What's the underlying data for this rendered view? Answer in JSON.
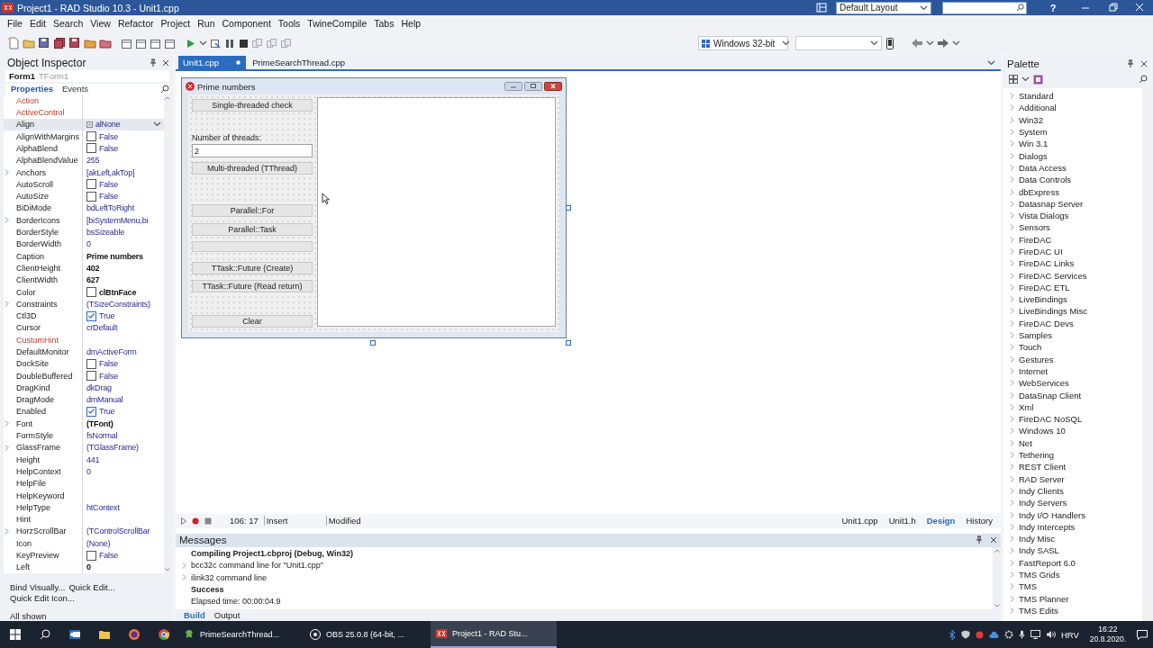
{
  "window": {
    "title": "Project1 - RAD Studio 10.3 - Unit1.cpp",
    "layout": "Default Layout",
    "help": "?"
  },
  "menu": [
    "File",
    "Edit",
    "Search",
    "View",
    "Refactor",
    "Project",
    "Run",
    "Component",
    "Tools",
    "TwineCompile",
    "Tabs",
    "Help"
  ],
  "toolbar": {
    "platform": "Windows 32-bit"
  },
  "object_inspector": {
    "title": "Object Inspector",
    "object": "Form1",
    "object_type": "TForm1",
    "tabs": [
      {
        "label": "Properties",
        "selected": true
      },
      {
        "label": "Events",
        "selected": false
      }
    ],
    "properties": [
      {
        "name": "Action",
        "kind": "text",
        "expandable": false,
        "reference": true,
        "selected": false
      },
      {
        "name": "ActiveControl",
        "kind": "text",
        "expandable": false,
        "reference": true,
        "selected": false
      },
      {
        "name": "Align",
        "value": "alNone",
        "kind": "dropdown",
        "modified": false,
        "expandable": false,
        "reference": false,
        "selected": true
      },
      {
        "name": "AlignWithMargins",
        "value": "False",
        "kind": "check",
        "checked": false,
        "modified": false,
        "expandable": false,
        "reference": false,
        "selected": false
      },
      {
        "name": "AlphaBlend",
        "value": "False",
        "kind": "check",
        "checked": false,
        "modified": false,
        "expandable": false,
        "reference": false,
        "selected": false
      },
      {
        "name": "AlphaBlendValue",
        "value": "255",
        "kind": "text",
        "modified": false,
        "expandable": false,
        "reference": false,
        "selected": false
      },
      {
        "name": "Anchors",
        "value": "[akLeft,akTop]",
        "kind": "text",
        "modified": false,
        "expandable": true,
        "reference": false,
        "selected": false
      },
      {
        "name": "AutoScroll",
        "value": "False",
        "kind": "check",
        "checked": false,
        "modified": false,
        "expandable": false,
        "reference": false,
        "selected": false
      },
      {
        "name": "AutoSize",
        "value": "False",
        "kind": "check",
        "checked": false,
        "modified": false,
        "expandable": false,
        "reference": false,
        "selected": false
      },
      {
        "name": "BiDiMode",
        "value": "bdLeftToRight",
        "kind": "text",
        "modified": false,
        "expandable": false,
        "reference": false,
        "selected": false
      },
      {
        "name": "BorderIcons",
        "value": "[biSystemMenu,bi",
        "kind": "text",
        "modified": false,
        "expandable": true,
        "reference": false,
        "selected": false
      },
      {
        "name": "BorderStyle",
        "value": "bsSizeable",
        "kind": "text",
        "modified": false,
        "expandable": false,
        "reference": false,
        "selected": false
      },
      {
        "name": "BorderWidth",
        "value": "0",
        "kind": "text",
        "modified": false,
        "expandable": false,
        "reference": false,
        "selected": false
      },
      {
        "name": "Caption",
        "value": "Prime numbers",
        "kind": "text",
        "modified": true,
        "expandable": false,
        "reference": false,
        "selected": false
      },
      {
        "name": "ClientHeight",
        "value": "402",
        "kind": "text",
        "modified": true,
        "expandable": false,
        "reference": false,
        "selected": false
      },
      {
        "name": "ClientWidth",
        "value": "627",
        "kind": "text",
        "modified": true,
        "expandable": false,
        "reference": false,
        "selected": false
      },
      {
        "name": "Color",
        "value": "clBtnFace",
        "kind": "swatch",
        "modified": true,
        "expandable": false,
        "reference": false,
        "selected": false
      },
      {
        "name": "Constraints",
        "value": "(TSizeConstraints)",
        "kind": "text",
        "modified": false,
        "expandable": true,
        "reference": false,
        "selected": false
      },
      {
        "name": "Ctl3D",
        "value": "True",
        "kind": "check",
        "checked": true,
        "modified": false,
        "expandable": false,
        "reference": false,
        "selected": false
      },
      {
        "name": "Cursor",
        "value": "crDefault",
        "kind": "text",
        "modified": false,
        "expandable": false,
        "reference": false,
        "selected": false
      },
      {
        "name": "CustomHint",
        "kind": "text",
        "expandable": false,
        "reference": true,
        "selected": false
      },
      {
        "name": "DefaultMonitor",
        "value": "dmActiveForm",
        "kind": "text",
        "modified": false,
        "expandable": false,
        "reference": false,
        "selected": false
      },
      {
        "name": "DockSite",
        "value": "False",
        "kind": "check",
        "checked": false,
        "modified": false,
        "expandable": false,
        "reference": false,
        "selected": false
      },
      {
        "name": "DoubleBuffered",
        "value": "False",
        "kind": "check",
        "checked": false,
        "modified": false,
        "expandable": false,
        "reference": false,
        "selected": false
      },
      {
        "name": "DragKind",
        "value": "dkDrag",
        "kind": "text",
        "modified": false,
        "expandable": false,
        "reference": false,
        "selected": false
      },
      {
        "name": "DragMode",
        "value": "dmManual",
        "kind": "text",
        "modified": false,
        "expandable": false,
        "reference": false,
        "selected": false
      },
      {
        "name": "Enabled",
        "value": "True",
        "kind": "check",
        "checked": true,
        "modified": false,
        "expandable": false,
        "reference": false,
        "selected": false
      },
      {
        "name": "Font",
        "value": "(TFont)",
        "kind": "text",
        "modified": true,
        "expandable": true,
        "reference": false,
        "selected": false
      },
      {
        "name": "FormStyle",
        "value": "fsNormal",
        "kind": "text",
        "modified": false,
        "expandable": false,
        "reference": false,
        "selected": false
      },
      {
        "name": "GlassFrame",
        "value": "(TGlassFrame)",
        "kind": "text",
        "modified": false,
        "expandable": true,
        "reference": false,
        "selected": false
      },
      {
        "name": "Height",
        "value": "441",
        "kind": "text",
        "modified": false,
        "expandable": false,
        "reference": false,
        "selected": false
      },
      {
        "name": "HelpContext",
        "value": "0",
        "kind": "text",
        "modified": false,
        "expandable": false,
        "reference": false,
        "selected": false
      },
      {
        "name": "HelpFile",
        "kind": "text",
        "expandable": false,
        "reference": false,
        "selected": false
      },
      {
        "name": "HelpKeyword",
        "kind": "text",
        "expandable": false,
        "reference": false,
        "selected": false
      },
      {
        "name": "HelpType",
        "value": "htContext",
        "kind": "text",
        "modified": false,
        "expandable": false,
        "reference": false,
        "selected": false
      },
      {
        "name": "Hint",
        "kind": "text",
        "expandable": false,
        "reference": false,
        "selected": false
      },
      {
        "name": "HorzScrollBar",
        "value": "(TControlScrollBar",
        "kind": "text",
        "modified": false,
        "expandable": true,
        "reference": false,
        "selected": false
      },
      {
        "name": "Icon",
        "value": "(None)",
        "kind": "text",
        "modified": false,
        "expandable": false,
        "reference": false,
        "selected": false
      },
      {
        "name": "KeyPreview",
        "value": "False",
        "kind": "check",
        "checked": false,
        "modified": false,
        "expandable": false,
        "reference": false,
        "selected": false
      },
      {
        "name": "Left",
        "value": "0",
        "kind": "text",
        "modified": true,
        "expandable": false,
        "reference": false,
        "selected": false
      }
    ],
    "links": [
      "Bind Visually...",
      "Quick Edit...",
      "Quick Edit Icon..."
    ],
    "filter": "All shown"
  },
  "editor_tabs": [
    {
      "label": "Unit1.cpp",
      "selected": true
    },
    {
      "label": "PrimeSearchThread.cpp",
      "selected": false
    }
  ],
  "form": {
    "caption": "Prime numbers",
    "controls": [
      {
        "kind": "button",
        "text": "Single-threaded check"
      },
      {
        "kind": "label",
        "text": "Number of threads:"
      },
      {
        "kind": "edit",
        "text": "2"
      },
      {
        "kind": "button",
        "text": "Multi-threaded (TThread)"
      },
      {
        "kind": "button",
        "text": "Parallel::For"
      },
      {
        "kind": "button",
        "text": "Parallel::Task"
      },
      {
        "kind": "progress",
        "level": 0
      },
      {
        "kind": "button",
        "text": "TTask::Future (Create)"
      },
      {
        "kind": "button",
        "text": "TTask::Future (Read return)"
      },
      {
        "kind": "button",
        "text": "Clear"
      }
    ]
  },
  "status_bar": {
    "position": "106: 17",
    "mode": "Insert",
    "state": "Modified",
    "views": [
      {
        "label": "Unit1.cpp",
        "selected": false
      },
      {
        "label": "Unit1.h",
        "selected": false
      },
      {
        "label": "Design",
        "selected": true
      },
      {
        "label": "History",
        "selected": false
      }
    ]
  },
  "messages": {
    "title": "Messages",
    "lines": [
      {
        "text": "Compiling Project1.cbproj (Debug, Win32)",
        "bold": true,
        "expandable": false
      },
      {
        "text": "bcc32c command line for \"Unit1.cpp\"",
        "bold": false,
        "expandable": true
      },
      {
        "text": "ilink32 command line",
        "bold": false,
        "expandable": true
      },
      {
        "text": "Success",
        "bold": true,
        "expandable": false
      },
      {
        "text": "Elapsed time: 00:00:04.9",
        "bold": false,
        "expandable": false
      }
    ],
    "tabs": [
      {
        "label": "Build",
        "selected": true
      },
      {
        "label": "Output",
        "selected": false
      }
    ]
  },
  "palette": {
    "title": "Palette",
    "categories": [
      {
        "label": "Standard",
        "expanded": false
      },
      {
        "label": "Additional",
        "expanded": false
      },
      {
        "label": "Win32",
        "expanded": false
      },
      {
        "label": "System",
        "expanded": false
      },
      {
        "label": "Win 3.1",
        "expanded": false
      },
      {
        "label": "Dialogs",
        "expanded": false
      },
      {
        "label": "Data Access",
        "expanded": false
      },
      {
        "label": "Data Controls",
        "expanded": false
      },
      {
        "label": "dbExpress",
        "expanded": false
      },
      {
        "label": "Datasnap Server",
        "expanded": false
      },
      {
        "label": "Vista Dialogs",
        "expanded": false
      },
      {
        "label": "Sensors",
        "expanded": false
      },
      {
        "label": "FireDAC",
        "expanded": false
      },
      {
        "label": "FireDAC UI",
        "expanded": false
      },
      {
        "label": "FireDAC Links",
        "expanded": false
      },
      {
        "label": "FireDAC Services",
        "expanded": false
      },
      {
        "label": "FireDAC ETL",
        "expanded": false
      },
      {
        "label": "LiveBindings",
        "expanded": false
      },
      {
        "label": "LiveBindings Misc",
        "expanded": false
      },
      {
        "label": "FireDAC Devs",
        "expanded": false
      },
      {
        "label": "Samples",
        "expanded": false
      },
      {
        "label": "Touch",
        "expanded": false
      },
      {
        "label": "Gestures",
        "expanded": false
      },
      {
        "label": "Internet",
        "expanded": false
      },
      {
        "label": "WebServices",
        "expanded": false
      },
      {
        "label": "DataSnap Client",
        "expanded": false
      },
      {
        "label": "Xml",
        "expanded": false
      },
      {
        "label": "FireDAC NoSQL",
        "expanded": false
      },
      {
        "label": "Windows 10",
        "expanded": false
      },
      {
        "label": "Net",
        "expanded": false
      },
      {
        "label": "Tethering",
        "expanded": false
      },
      {
        "label": "REST Client",
        "expanded": false
      },
      {
        "label": "RAD Server",
        "expanded": false
      },
      {
        "label": "Indy Clients",
        "expanded": false
      },
      {
        "label": "Indy Servers",
        "expanded": false
      },
      {
        "label": "Indy I/O Handlers",
        "expanded": false
      },
      {
        "label": "Indy Intercepts",
        "expanded": false
      },
      {
        "label": "Indy Misc",
        "expanded": false
      },
      {
        "label": "Indy SASL",
        "expanded": false
      },
      {
        "label": "FastReport 6.0",
        "expanded": false
      },
      {
        "label": "TMS Grids",
        "expanded": false
      },
      {
        "label": "TMS",
        "expanded": false
      },
      {
        "label": "TMS Planner",
        "expanded": false
      },
      {
        "label": "TMS Edits",
        "expanded": false
      }
    ]
  },
  "taskbar": {
    "apps": [
      {
        "label": "PrimeSearchThread...",
        "selected": false
      },
      {
        "label": "OBS 25.0.8 (64-bit, ...",
        "selected": false
      },
      {
        "label": "Project1 - RAD Stu...",
        "selected": true
      }
    ],
    "language": "HRV",
    "time": "16:22",
    "date": "20.8.2020."
  }
}
